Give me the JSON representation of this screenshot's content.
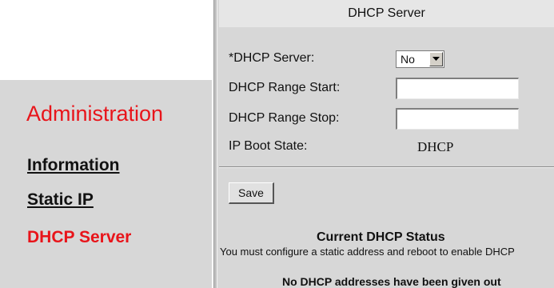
{
  "sidebar": {
    "heading": "Administration",
    "items": [
      {
        "label": "Information",
        "active": false
      },
      {
        "label": "Static IP",
        "active": false
      },
      {
        "label": "DHCP Server",
        "active": true
      }
    ]
  },
  "main": {
    "title": "DHCP Server",
    "form": {
      "dhcp_server_label": "*DHCP Server:",
      "dhcp_server_value": "No",
      "range_start_label": "DHCP Range Start:",
      "range_start_value": "",
      "range_stop_label": "DHCP Range Stop:",
      "range_stop_value": "",
      "ip_boot_state_label": "IP Boot State:",
      "ip_boot_state_value": "DHCP"
    },
    "save_label": "Save",
    "status": {
      "title": "Current DHCP Status",
      "message": "You must configure a static address and reboot to enable DHCP",
      "addresses": "No DHCP addresses have been given out"
    }
  },
  "colors": {
    "accent_red": "#e8141a",
    "panel_gray": "#d7d7d7",
    "title_bar_gray": "#e6e6e6"
  },
  "icons": {
    "select_arrow": "chevron-down-icon"
  }
}
